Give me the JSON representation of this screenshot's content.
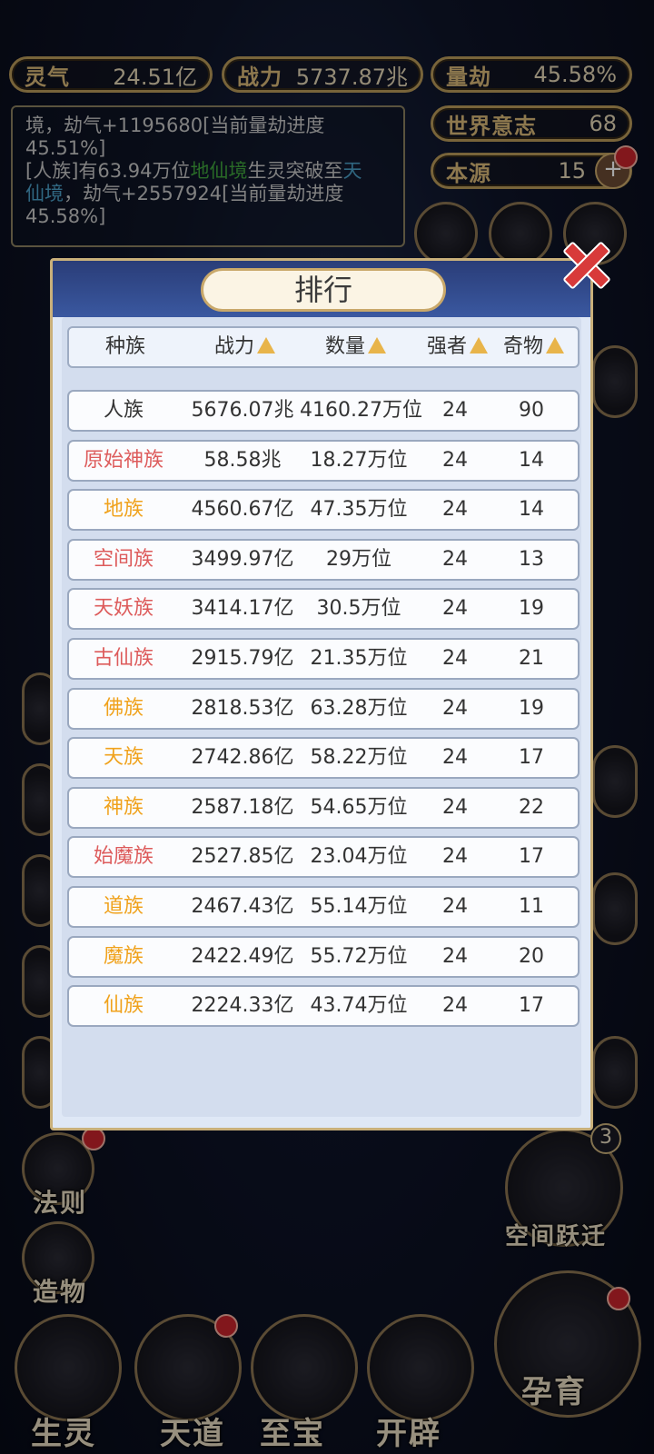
{
  "stats": {
    "lingqi": {
      "label": "灵气",
      "value": "24.51亿"
    },
    "zhanli": {
      "label": "战力",
      "value": "5737.87兆"
    },
    "liangjie": {
      "label": "量劫",
      "value": "45.58%"
    },
    "shijie": {
      "label": "世界意志",
      "value": "68"
    },
    "benyuan": {
      "label": "本源",
      "value": "15",
      "plus": "+"
    }
  },
  "log": {
    "line1": "境，劫气+1195680[当前量劫进度",
    "line2": "45.51%]",
    "line3a": "[人族]有63.94万位",
    "line3b": "地仙境",
    "line3c": "生灵突破至",
    "line3d": "天",
    "line4a": "仙境",
    "line4b": "，劫气+2557924[当前量劫进度",
    "line5": "45.58%]"
  },
  "modal": {
    "title": "排行",
    "headers": [
      "种族",
      "战力",
      "数量",
      "强者",
      "奇物"
    ],
    "rows": [
      {
        "name": "人族",
        "power": "5676.07兆",
        "count": "4160.27万位",
        "strong": "24",
        "items": "90",
        "color": "dark"
      },
      {
        "name": "原始神族",
        "power": "58.58兆",
        "count": "18.27万位",
        "strong": "24",
        "items": "14",
        "color": "red"
      },
      {
        "name": "地族",
        "power": "4560.67亿",
        "count": "47.35万位",
        "strong": "24",
        "items": "14",
        "color": "orange"
      },
      {
        "name": "空间族",
        "power": "3499.97亿",
        "count": "29万位",
        "strong": "24",
        "items": "13",
        "color": "red"
      },
      {
        "name": "天妖族",
        "power": "3414.17亿",
        "count": "30.5万位",
        "strong": "24",
        "items": "19",
        "color": "red"
      },
      {
        "name": "古仙族",
        "power": "2915.79亿",
        "count": "21.35万位",
        "strong": "24",
        "items": "21",
        "color": "red"
      },
      {
        "name": "佛族",
        "power": "2818.53亿",
        "count": "63.28万位",
        "strong": "24",
        "items": "19",
        "color": "orange"
      },
      {
        "name": "天族",
        "power": "2742.86亿",
        "count": "58.22万位",
        "strong": "24",
        "items": "17",
        "color": "orange"
      },
      {
        "name": "神族",
        "power": "2587.18亿",
        "count": "54.65万位",
        "strong": "24",
        "items": "22",
        "color": "orange"
      },
      {
        "name": "始魔族",
        "power": "2527.85亿",
        "count": "23.04万位",
        "strong": "24",
        "items": "17",
        "color": "red"
      },
      {
        "name": "道族",
        "power": "2467.43亿",
        "count": "55.14万位",
        "strong": "24",
        "items": "11",
        "color": "orange"
      },
      {
        "name": "魔族",
        "power": "2422.49亿",
        "count": "55.72万位",
        "strong": "24",
        "items": "20",
        "color": "orange"
      },
      {
        "name": "仙族",
        "power": "2224.33亿",
        "count": "43.74万位",
        "strong": "24",
        "items": "17",
        "color": "orange"
      }
    ]
  },
  "side": {
    "fazhe": "法则",
    "zaowu": "造物",
    "kongjian": "空间跃迁",
    "kongjian_badge": "3"
  },
  "bottom": {
    "shengling": "生灵",
    "tiandao": "天道",
    "zhibao": "至宝",
    "kaipi": "开辟",
    "yunyu": "孕育"
  }
}
